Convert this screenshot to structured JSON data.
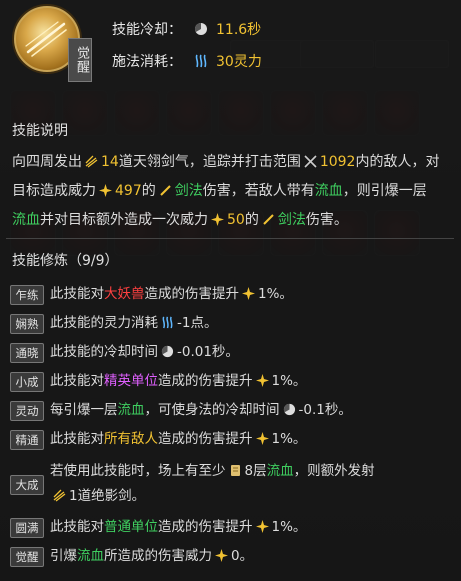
{
  "skill": {
    "awaken_tag": "觉醒",
    "cooldown_label": "技能冷却：",
    "cooldown_value": "11.6秒",
    "cost_label": "施法消耗：",
    "cost_value": "30灵力"
  },
  "description": {
    "title": "技能说明",
    "t1": "向四周发出",
    "n1": "14",
    "t2": "道天翎剑气，追踪并打击范围",
    "n2": "1092",
    "t3": "内的敌人，对",
    "t4": "目标造成威力",
    "n3": "497",
    "t5": "的",
    "k1": "剑法",
    "t6": "伤害，若敌人带有",
    "k2": "流血",
    "t7": "，则引爆一层",
    "k3": "流血",
    "t8": "并对目标额外造成一次威力",
    "n4": "50",
    "t9": "的",
    "k4": "剑法",
    "t10": "伤害。"
  },
  "cultivation": {
    "title": "技能修炼（9/9）",
    "mods": [
      {
        "tag": "乍练",
        "a": "此技能对",
        "b": "大妖兽",
        "c": "造成的伤害提升",
        "d": "1%。"
      },
      {
        "tag": "娴熟",
        "a": "此技能的灵力消耗",
        "b": "",
        "c": "",
        "d": "-1点。"
      },
      {
        "tag": "通晓",
        "a": "此技能的冷却时间",
        "b": "",
        "c": "",
        "d": "-0.01秒。"
      },
      {
        "tag": "小成",
        "a": "此技能对",
        "b": "精英单位",
        "c": "造成的伤害提升",
        "d": "1%。"
      },
      {
        "tag": "灵动",
        "a": "每引爆一层",
        "b": "流血",
        "c": "，可使身法的冷却时间",
        "d": "-0.1秒。"
      },
      {
        "tag": "精通",
        "a": "此技能对",
        "b": "所有敌人",
        "c": "造成的伤害提升",
        "d": "1%。"
      },
      {
        "tag": "大成",
        "a": "若使用此技能时，场上有至少",
        "b": "8层",
        "b2": "流血",
        "c": "，则额外发射",
        "d": "1道绝影剑。"
      },
      {
        "tag": "圆满",
        "a": "此技能对",
        "b": "普通单位",
        "c": "造成的伤害提升",
        "d": "1%。"
      },
      {
        "tag": "觉醒",
        "a": "引爆",
        "b": "流血",
        "c": "所造成的伤害威力",
        "d": "0。"
      }
    ]
  },
  "colors": {
    "highlight_yellow": "#f1c232",
    "highlight_green": "#3fcf60",
    "highlight_red": "#ff4040",
    "highlight_purple": "#e060ff"
  },
  "icons": [
    "cooldown-clock-icon",
    "spirit-wave-icon",
    "sword-qi-icon",
    "range-cross-icon",
    "power-star-icon",
    "sword-icon",
    "stack-scroll-icon"
  ]
}
